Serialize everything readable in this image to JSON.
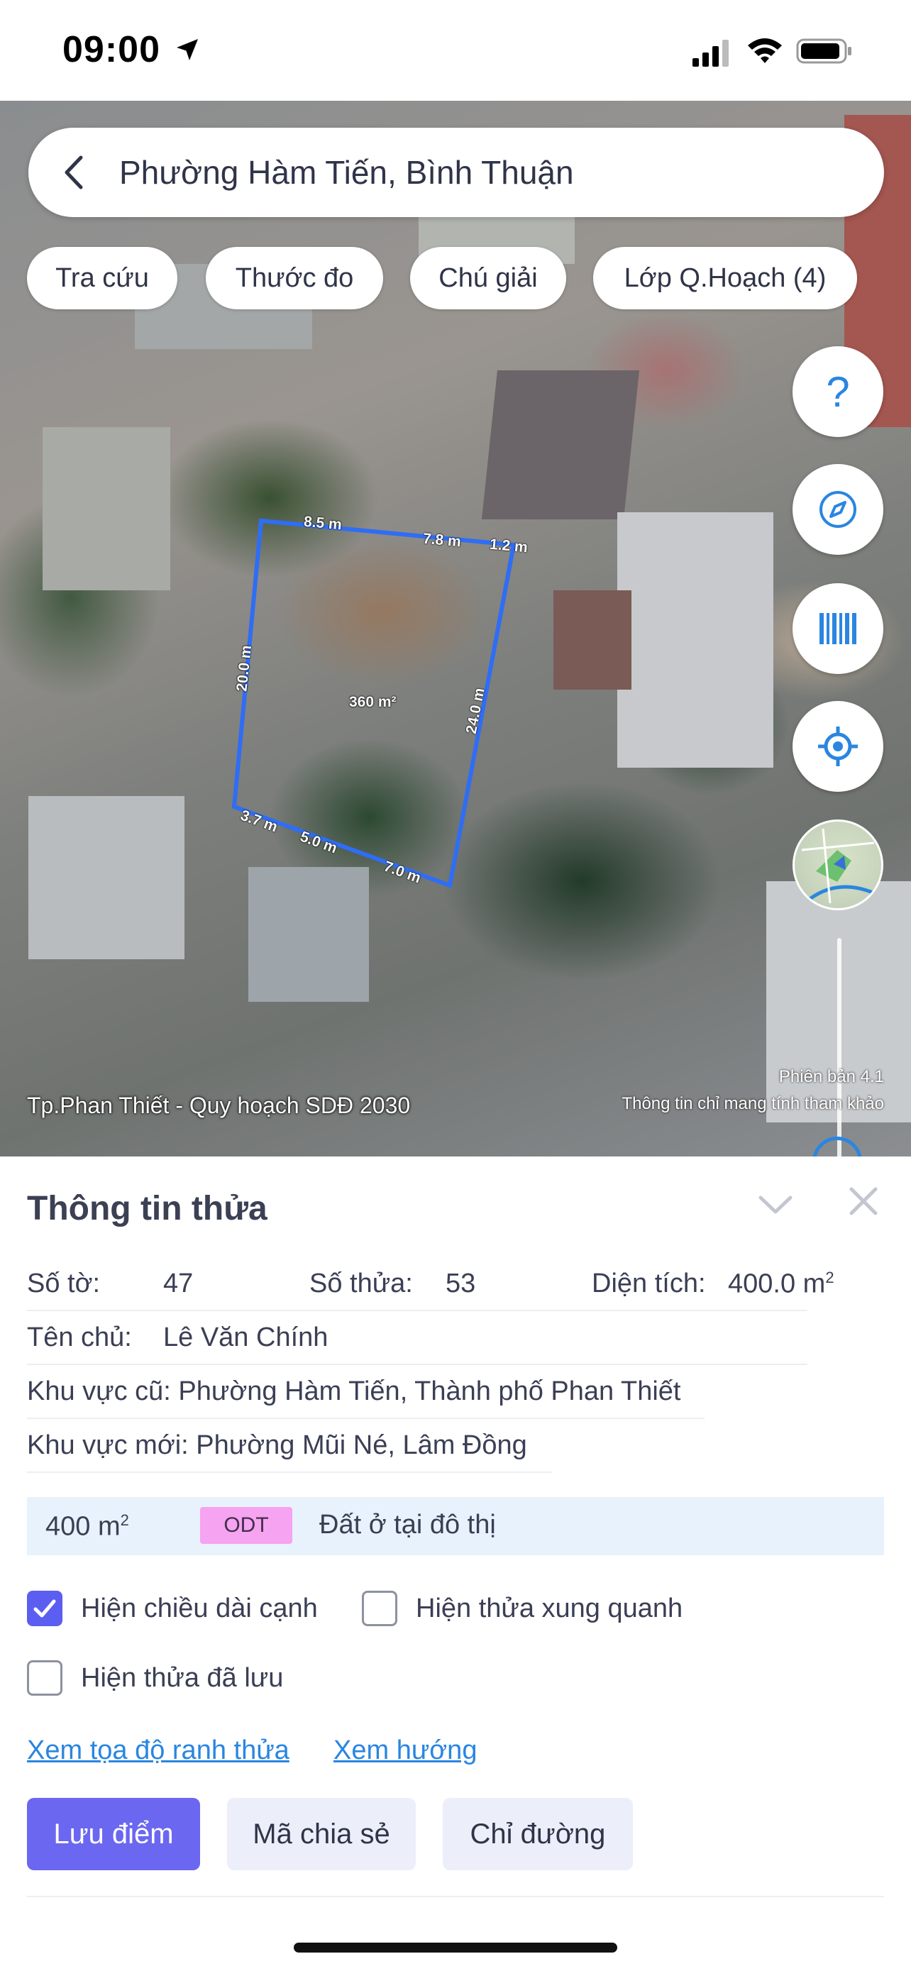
{
  "status_bar": {
    "time": "09:00"
  },
  "search": {
    "text": "Phường Hàm Tiến, Bình Thuận"
  },
  "chips": [
    "Tra cứu",
    "Thước đo",
    "Chú giải",
    "Lớp Q.Hoạch (4)"
  ],
  "fabs": {
    "help": "?",
    "icons": [
      "question-icon",
      "compass-icon",
      "barcode-icon",
      "locate-icon"
    ]
  },
  "map": {
    "parcel_labels": {
      "top_a": "8.5 m",
      "top_b": "7.8 m",
      "top_c": "1.2 m",
      "left": "20.0 m",
      "right": "24.0 m",
      "area": "360 m²",
      "bottom_a": "3.7 m",
      "bottom_b": "5.0 m",
      "bottom_c": "7.0 m"
    },
    "caption_left": "Tp.Phan Thiết - Quy hoạch SDĐ 2030",
    "version": "Phiên bản 4.1",
    "disclaimer": "Thông tin chỉ mang tính tham khảo"
  },
  "panel": {
    "title": "Thông tin thửa",
    "so_to_label": "Số tờ:",
    "so_to": "47",
    "so_thua_label": "Số thửa:",
    "so_thua": "53",
    "dien_tich_label": "Diện tích:",
    "dien_tich": "400.0 m",
    "dien_tich_sup": "2",
    "ten_chu_label": "Tên chủ:",
    "ten_chu": "Lê Văn Chính",
    "khu_vuc_cu": "Khu vực cũ: Phường Hàm Tiến, Thành phố Phan Thiết",
    "khu_vuc_moi": "Khu vực mới: Phường Mũi Né, Lâm Đồng",
    "area_row": {
      "value": "400 m",
      "sup": "2",
      "code": "ODT",
      "type": "Đất ở tại đô thị",
      "code_color": "#f6a3f1"
    },
    "checkboxes": [
      {
        "label": "Hiện chiều dài cạnh",
        "checked": true
      },
      {
        "label": "Hiện thửa xung quanh",
        "checked": false
      },
      {
        "label": "Hiện thửa đã lưu",
        "checked": false
      }
    ],
    "links": [
      "Xem tọa độ ranh thửa",
      "Xem hướng"
    ],
    "buttons": [
      "Lưu điểm",
      "Mã chia sẻ",
      "Chỉ đường"
    ]
  },
  "colors": {
    "accent": "#6b67f0",
    "parcel_outline": "#2f6df5",
    "link": "#2a86e0"
  }
}
